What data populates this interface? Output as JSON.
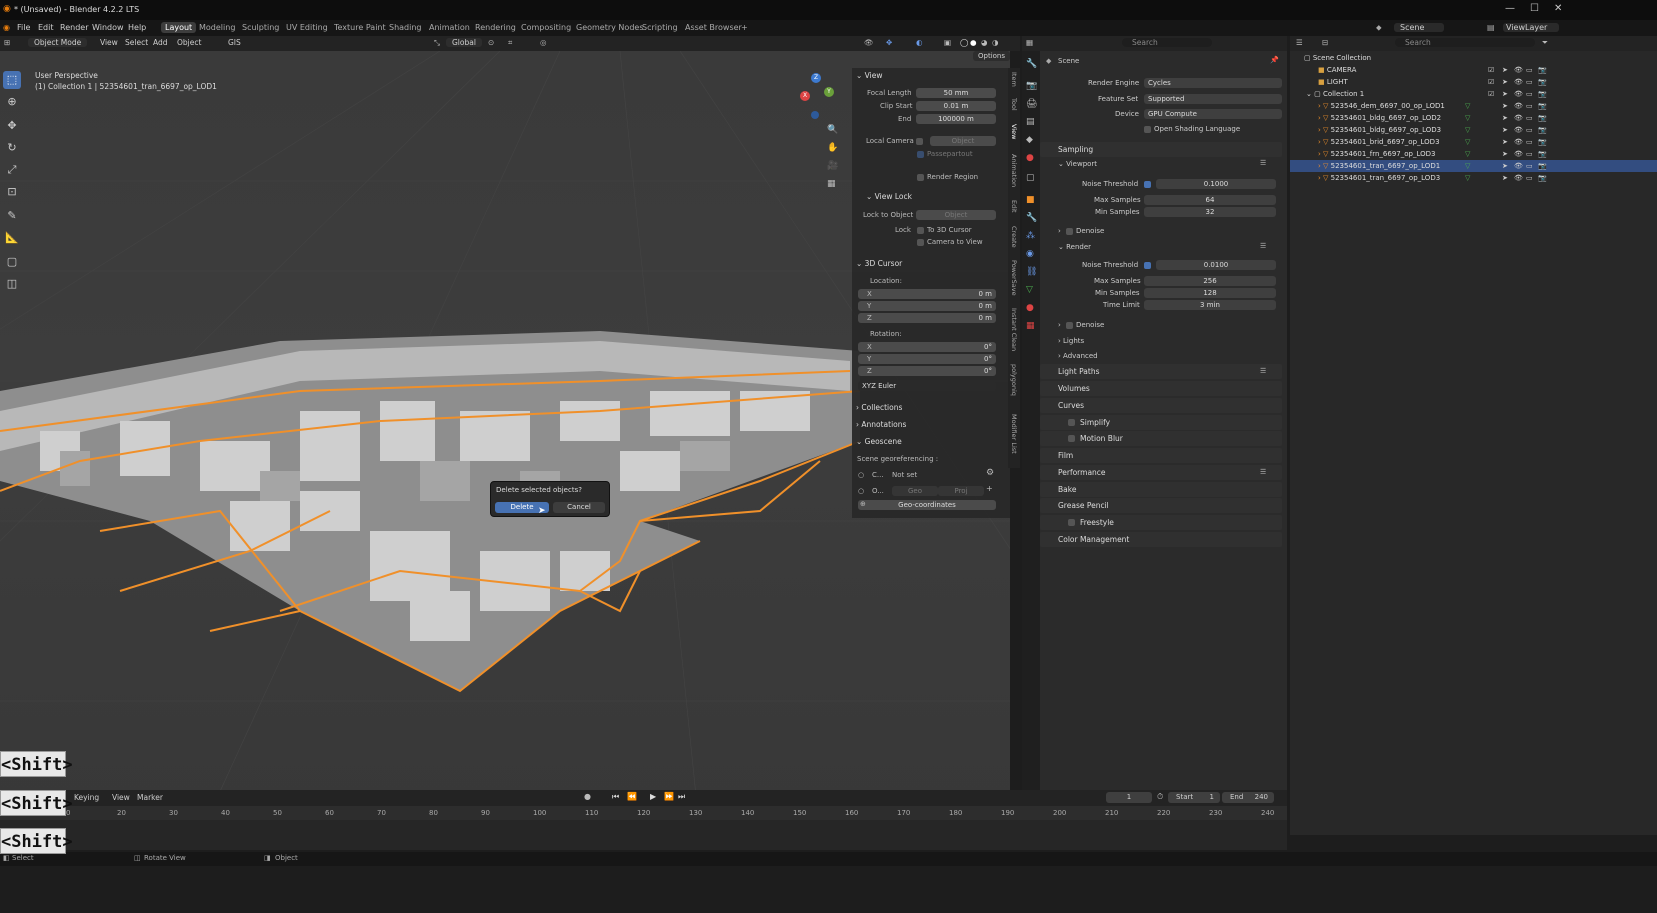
{
  "window": {
    "title": "* (Unsaved) - Blender 4.2.2 LTS",
    "min": "—",
    "max": "☐",
    "close": "✕"
  },
  "menu": {
    "file": "File",
    "edit": "Edit",
    "render": "Render",
    "window": "Window",
    "help": "Help"
  },
  "workspaces": [
    "Layout",
    "Modeling",
    "Sculpting",
    "UV Editing",
    "Texture Paint",
    "Shading",
    "Animation",
    "Rendering",
    "Compositing",
    "Geometry Nodes",
    "Scripting",
    "Asset Browser"
  ],
  "topright": {
    "scene": "Scene",
    "viewlayer": "ViewLayer"
  },
  "viewport_header": {
    "mode": "Object Mode",
    "view": "View",
    "select": "Select",
    "add": "Add",
    "object": "Object",
    "gis": "GIS",
    "orientation": "Global",
    "options": "Options"
  },
  "viewport": {
    "perspective": "User Perspective",
    "collection_info": "(1) Collection 1 | 52354601_tran_6697_op_LOD1",
    "gizmo_z": "Z",
    "gizmo_y": "Y",
    "gizmo_x": "X"
  },
  "npanel": {
    "view_title": "View",
    "focal_label": "Focal Length",
    "focal_value": "50 mm",
    "clip_start_label": "Clip Start",
    "clip_start_value": "0.01 m",
    "end_label": "End",
    "end_value": "100000 m",
    "local_camera": "Local Camera",
    "object_placeholder": "Object",
    "passepartout": "Passepartout",
    "render_region": "Render Region",
    "view_lock": "View Lock",
    "lock_to_object": "Lock to Object",
    "lock": "Lock",
    "to_3d_cursor": "To 3D Cursor",
    "camera_to_view": "Camera to View",
    "cursor_title": "3D Cursor",
    "location": "Location:",
    "x": "X",
    "y": "Y",
    "z": "Z",
    "loc_x": "0 m",
    "loc_y": "0 m",
    "loc_z": "0 m",
    "rotation": "Rotation:",
    "rot_x": "0°",
    "rot_y": "0°",
    "rot_z": "0°",
    "euler": "XYZ Euler",
    "collections": "Collections",
    "annotations": "Annotations",
    "geoscene": "Geoscene",
    "scene_georef": "Scene georeferencing :",
    "crs_label": "C...",
    "crs_value": "Not set",
    "origin_label": "O...",
    "geo": "Geo",
    "proj": "Proj",
    "geo_coordinates": "Geo-coordinates"
  },
  "vtabs": [
    "Item",
    "Tool",
    "View",
    "Animation",
    "Edit",
    "Create",
    "PowerSave",
    "Instant Clean",
    "polygoniq",
    "Modifier List"
  ],
  "dialog": {
    "title": "Delete selected objects?",
    "delete": "Delete",
    "cancel": "Cancel"
  },
  "properties": {
    "search": "Search",
    "scene": "Scene",
    "render_engine_label": "Render Engine",
    "render_engine": "Cycles",
    "feature_set_label": "Feature Set",
    "feature_set": "Supported",
    "device_label": "Device",
    "device": "GPU Compute",
    "osl": "Open Shading Language",
    "sampling": "Sampling",
    "viewport": "Viewport",
    "noise_threshold": "Noise Threshold",
    "vp_noise": "0.1000",
    "max_samples": "Max Samples",
    "vp_max": "64",
    "min_samples": "Min Samples",
    "vp_min": "32",
    "denoise": "Denoise",
    "render": "Render",
    "r_noise": "0.0100",
    "r_max": "256",
    "r_min": "128",
    "time_limit": "Time Limit",
    "r_time": "3 min",
    "lights": "Lights",
    "advanced": "Advanced",
    "sections": [
      "Light Paths",
      "Volumes",
      "Curves",
      "Simplify",
      "Motion Blur",
      "Film",
      "Performance",
      "Bake",
      "Grease Pencil",
      "Freestyle",
      "Color Management"
    ]
  },
  "outliner": {
    "search": "Search",
    "scene_collection": "Scene Collection",
    "camera": "CAMERA",
    "light": "LIGHT",
    "collection1": "Collection 1",
    "items": [
      "523546_dem_6697_00_op_LOD1",
      "52354601_bldg_6697_op_LOD2",
      "52354601_bldg_6697_op_LOD3",
      "52354601_brid_6697_op_LOD3",
      "52354601_frn_6697_op_LOD3",
      "52354601_tran_6697_op_LOD1",
      "52354601_tran_6697_op_LOD3"
    ]
  },
  "timeline": {
    "keying": "Keying",
    "view": "View",
    "marker": "Marker",
    "current_frame": "1",
    "start_label": "Start",
    "start": "1",
    "end_label": "End",
    "end": "240",
    "ticks": [
      "0",
      "20",
      "30",
      "40",
      "50",
      "60",
      "70",
      "80",
      "90",
      "100",
      "110",
      "120",
      "130",
      "140",
      "150",
      "160",
      "170",
      "180",
      "190",
      "200",
      "210",
      "220",
      "230",
      "240"
    ]
  },
  "status": {
    "select": "Select",
    "rotate": "Rotate View",
    "object": "Object"
  },
  "overlay": {
    "shift": "<Shift>"
  },
  "colors": {
    "accent": "#4772b3",
    "selected_outline": "#f0902a",
    "selection_row": "#334d80"
  }
}
